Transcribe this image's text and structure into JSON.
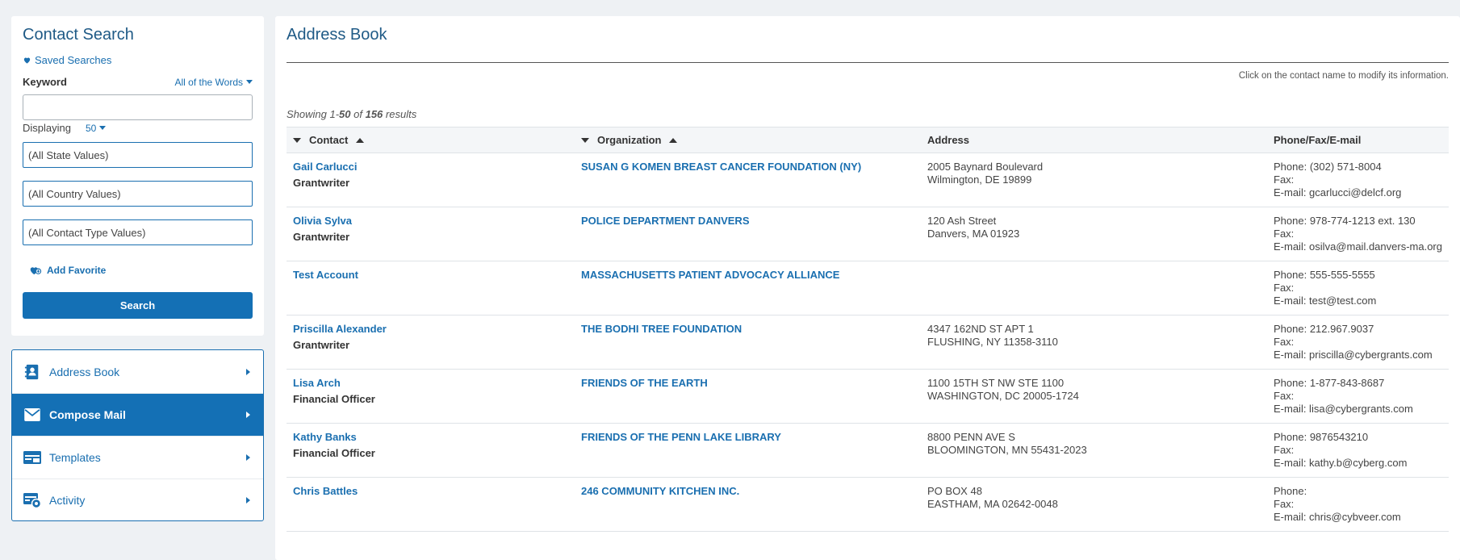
{
  "search": {
    "title": "Contact Search",
    "saved_searches": "Saved Searches",
    "keyword_label": "Keyword",
    "match_mode": "All of the Words",
    "keyword_value": "",
    "displaying_label": "Displaying",
    "displaying_value": "50",
    "state": "(All State Values)",
    "country": "(All Country Values)",
    "contact_type": "(All Contact Type Values)",
    "add_favorite": "Add Favorite",
    "search_button": "Search"
  },
  "nav": {
    "items": [
      {
        "label": "Address Book",
        "icon": "address-book-icon"
      },
      {
        "label": "Compose Mail",
        "icon": "envelope-icon"
      },
      {
        "label": "Templates",
        "icon": "template-icon"
      },
      {
        "label": "Activity",
        "icon": "activity-icon"
      }
    ]
  },
  "main": {
    "title": "Address Book",
    "hint": "Click on the contact name to modify its information.",
    "showing_prefix": "Showing 1-",
    "showing_end": "50",
    "showing_of": " of ",
    "showing_total": "156",
    "showing_suffix": " results",
    "columns": {
      "contact": "Contact",
      "organization": "Organization",
      "address": "Address",
      "phone": "Phone/Fax/E-mail"
    },
    "rows": [
      {
        "name": "Gail Carlucci",
        "title": "Grantwriter",
        "org": "SUSAN G KOMEN BREAST CANCER FOUNDATION (NY)",
        "addr1": "2005 Baynard Boulevard",
        "addr2": "Wilmington, DE 19899",
        "phone": "Phone: (302) 571-8004",
        "fax": "Fax:",
        "email": "E-mail: gcarlucci@delcf.org"
      },
      {
        "name": "Olivia Sylva",
        "title": "Grantwriter",
        "org": "POLICE DEPARTMENT DANVERS",
        "addr1": "120 Ash Street",
        "addr2": "Danvers, MA 01923",
        "phone": "Phone: 978-774-1213 ext. 130",
        "fax": "Fax:",
        "email": "E-mail: osilva@mail.danvers-ma.org"
      },
      {
        "name": "Test Account",
        "title": "",
        "org": "MASSACHUSETTS PATIENT ADVOCACY ALLIANCE",
        "addr1": "",
        "addr2": "",
        "phone": "Phone: 555-555-5555",
        "fax": "Fax:",
        "email": "E-mail: test@test.com"
      },
      {
        "name": "Priscilla Alexander",
        "title": "Grantwriter",
        "org": "THE BODHI TREE FOUNDATION",
        "addr1": "4347 162ND ST APT 1",
        "addr2": "FLUSHING, NY 11358-3110",
        "phone": "Phone: 212.967.9037",
        "fax": "Fax:",
        "email": "E-mail: priscilla@cybergrants.com"
      },
      {
        "name": "Lisa Arch",
        "title": "Financial Officer",
        "org": "FRIENDS OF THE EARTH",
        "addr1": "1100 15TH ST NW STE 1100",
        "addr2": "WASHINGTON, DC 20005-1724",
        "phone": "Phone: 1-877-843-8687",
        "fax": "Fax:",
        "email": "E-mail: lisa@cybergrants.com"
      },
      {
        "name": "Kathy Banks",
        "title": "Financial Officer",
        "org": "FRIENDS OF THE PENN LAKE LIBRARY",
        "addr1": "8800 PENN AVE S",
        "addr2": "BLOOMINGTON, MN 55431-2023",
        "phone": "Phone: 9876543210",
        "fax": "Fax:",
        "email": "E-mail: kathy.b@cyberg.com"
      },
      {
        "name": "Chris Battles",
        "title": "",
        "org": "246 COMMUNITY KITCHEN INC.",
        "addr1": "PO BOX 48",
        "addr2": "EASTHAM, MA 02642-0048",
        "phone": "Phone:",
        "fax": "Fax:",
        "email": "E-mail: chris@cybveer.com"
      }
    ]
  }
}
